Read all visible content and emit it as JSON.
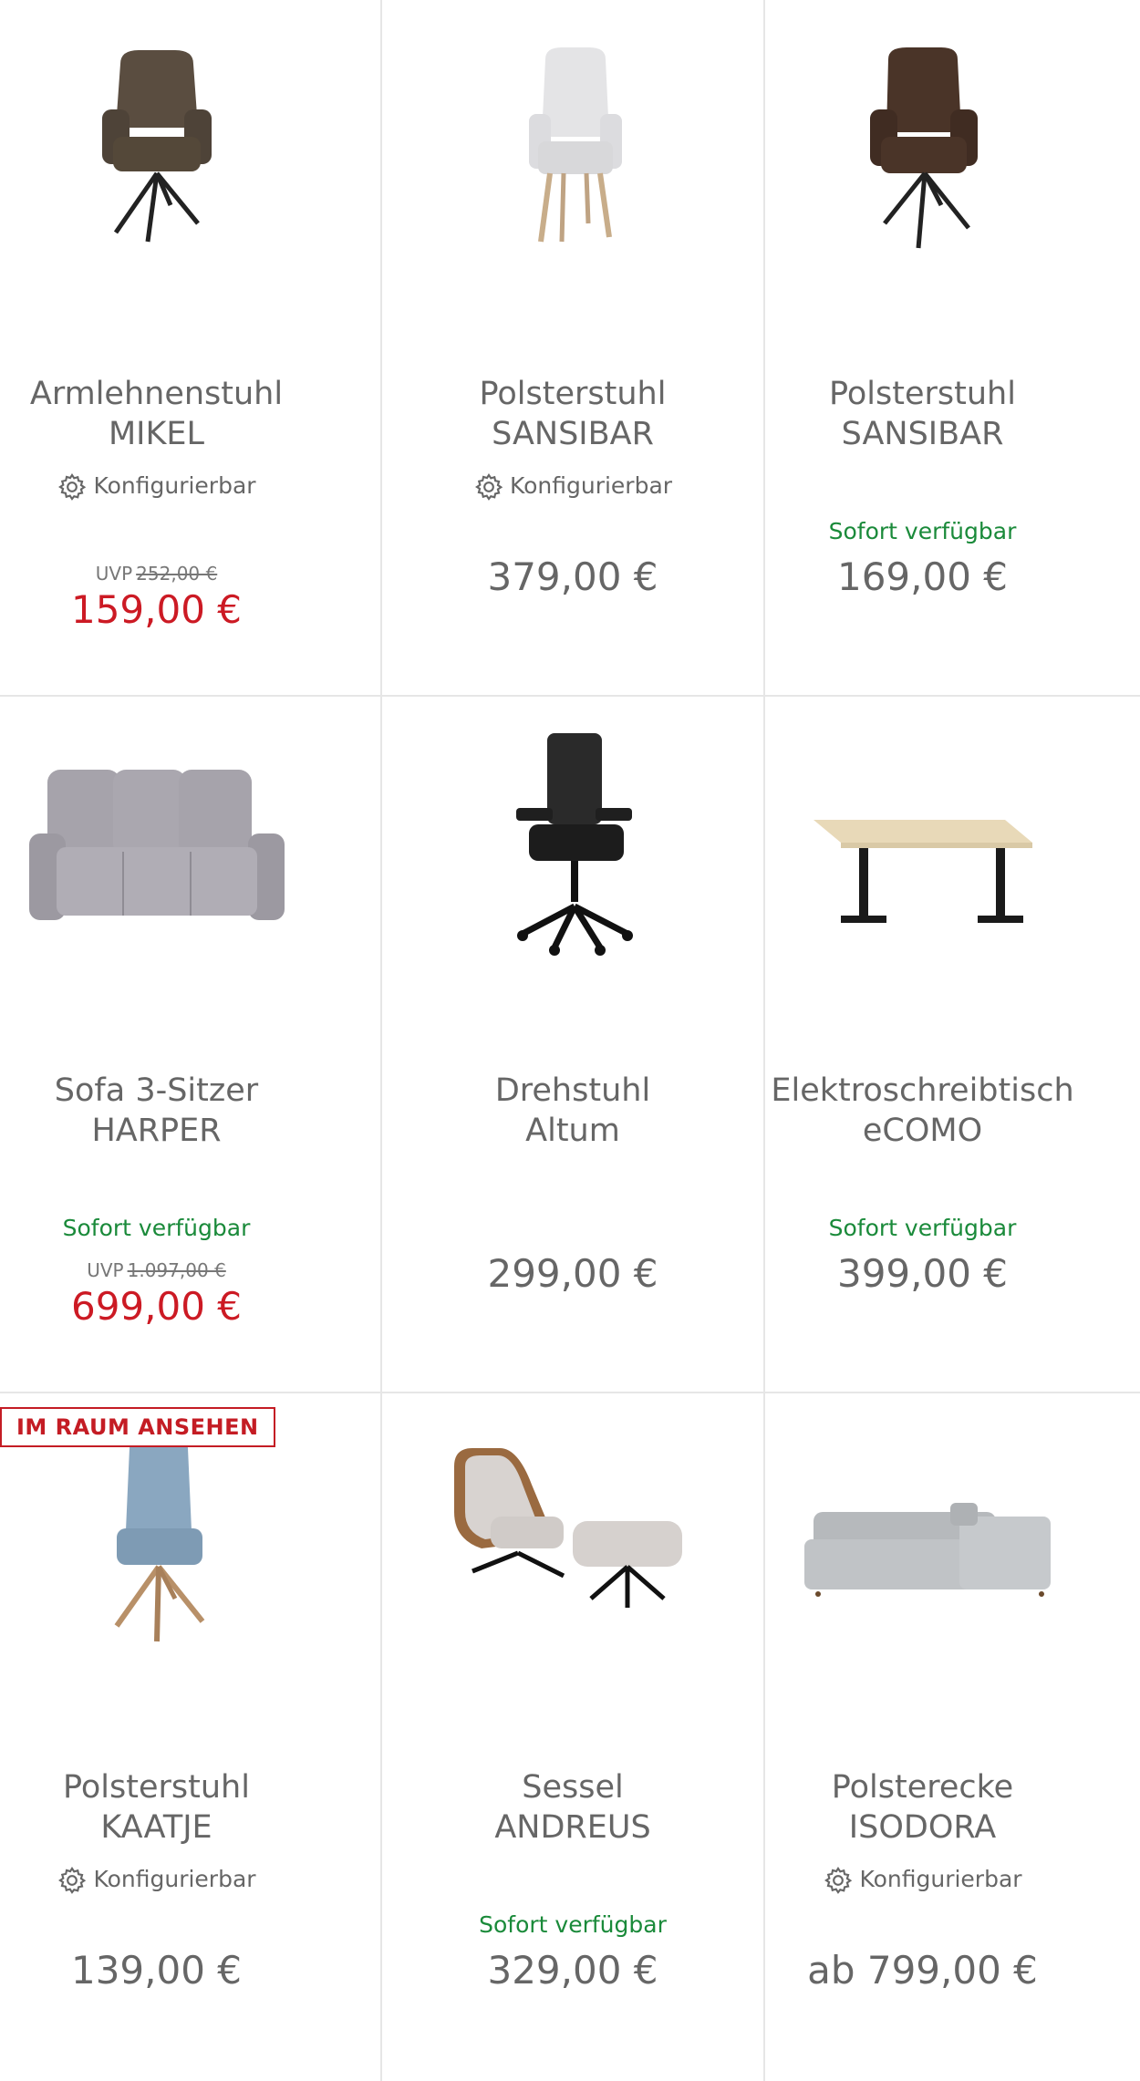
{
  "products": [
    {
      "name_line1": "Armlehnenstuhl",
      "name_line2": "MIKEL",
      "configurable": "Konfigurierbar",
      "availability": "",
      "uvp_label": "UVP",
      "uvp_price": "252,00 €",
      "price": "159,00 €",
      "badge": "",
      "image": "armchair-dark-brown"
    },
    {
      "name_line1": "Polsterstuhl",
      "name_line2": "SANSIBAR",
      "configurable": "Konfigurierbar",
      "availability": "",
      "uvp_label": "",
      "uvp_price": "",
      "price": "379,00 €",
      "badge": "",
      "image": "chair-white"
    },
    {
      "name_line1": "Polsterstuhl",
      "name_line2": "SANSIBAR",
      "configurable": "",
      "availability": "Sofort verfügbar",
      "uvp_label": "",
      "uvp_price": "",
      "price": "169,00 €",
      "badge": "",
      "image": "armchair-brown"
    },
    {
      "name_line1": "Sofa 3-Sitzer",
      "name_line2": "HARPER",
      "configurable": "",
      "availability": "Sofort verfügbar",
      "uvp_label": "UVP",
      "uvp_price": "1.097,00 €",
      "price": "699,00 €",
      "badge": "",
      "image": "sofa-grey"
    },
    {
      "name_line1": "Drehstuhl",
      "name_line2": "Altum",
      "configurable": "",
      "availability": "",
      "uvp_label": "",
      "uvp_price": "",
      "price": "299,00 €",
      "badge": "",
      "image": "office-chair"
    },
    {
      "name_line1": "Elektroschreibtisch",
      "name_line2": "eCOMO",
      "configurable": "",
      "availability": "Sofort verfügbar",
      "uvp_label": "",
      "uvp_price": "",
      "price": "399,00 €",
      "badge": "",
      "image": "desk"
    },
    {
      "name_line1": "Polsterstuhl",
      "name_line2": "KAATJE",
      "configurable": "Konfigurierbar",
      "availability": "",
      "uvp_label": "",
      "uvp_price": "",
      "price": "139,00 €",
      "badge": "IM RAUM ANSEHEN",
      "image": "chair-blue"
    },
    {
      "name_line1": "Sessel",
      "name_line2": "ANDREUS",
      "configurable": "",
      "availability": "Sofort verfügbar",
      "uvp_label": "",
      "uvp_price": "",
      "price": "329,00 €",
      "badge": "",
      "image": "lounge-chair"
    },
    {
      "name_line1": "Polsterecke",
      "name_line2": "ISODORA",
      "configurable": "Konfigurierbar",
      "availability": "",
      "uvp_label": "",
      "uvp_price": "",
      "price": "ab 799,00 €",
      "badge": "",
      "image": "corner-sofa"
    }
  ],
  "colors": {
    "sale": "#cc1a24",
    "available": "#1a8a3a",
    "text": "#666666",
    "border": "#e6e6e6"
  }
}
